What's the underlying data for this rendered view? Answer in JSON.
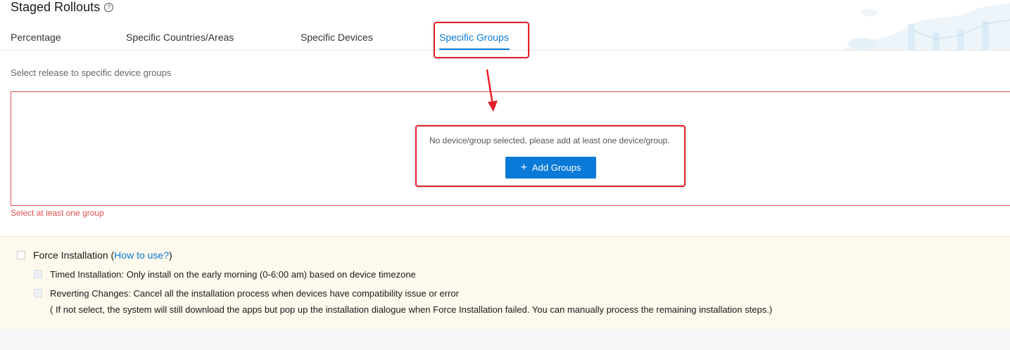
{
  "page": {
    "title": "Staged Rollouts",
    "help_icon": "question-circle-icon"
  },
  "tabs": [
    {
      "label": "Percentage",
      "active": false
    },
    {
      "label": "Specific Countries/Areas",
      "active": false
    },
    {
      "label": "Specific Devices",
      "active": false
    },
    {
      "label": "Specific Groups",
      "active": true
    }
  ],
  "groups": {
    "hint": "Select release to specific device groups",
    "empty_text": "No device/group selected, please add at least one device/group.",
    "add_button_label": "Add Groups",
    "add_icon": "plus-icon",
    "error": "Select at least one group"
  },
  "force_installation": {
    "label": "Force Installation (",
    "link": "How to use?",
    "label_close": ")",
    "checked": false,
    "options": [
      {
        "label": "Timed Installation: Only install on the early morning (0-6:00 am) based on device timezone",
        "checked": false
      },
      {
        "label": "Reverting Changes: Cancel all the installation process when devices have compatibility issue or error",
        "checked": false
      }
    ],
    "note": "( If not select, the system will still download the apps but pop up the installation dialogue when Force Installation failed. You can manually process the remaining installation steps.)"
  },
  "colors": {
    "accent": "#0a7ad8",
    "error": "#e0504f",
    "annotation": "#e5202a",
    "panel_bg": "#fdf9ec"
  }
}
